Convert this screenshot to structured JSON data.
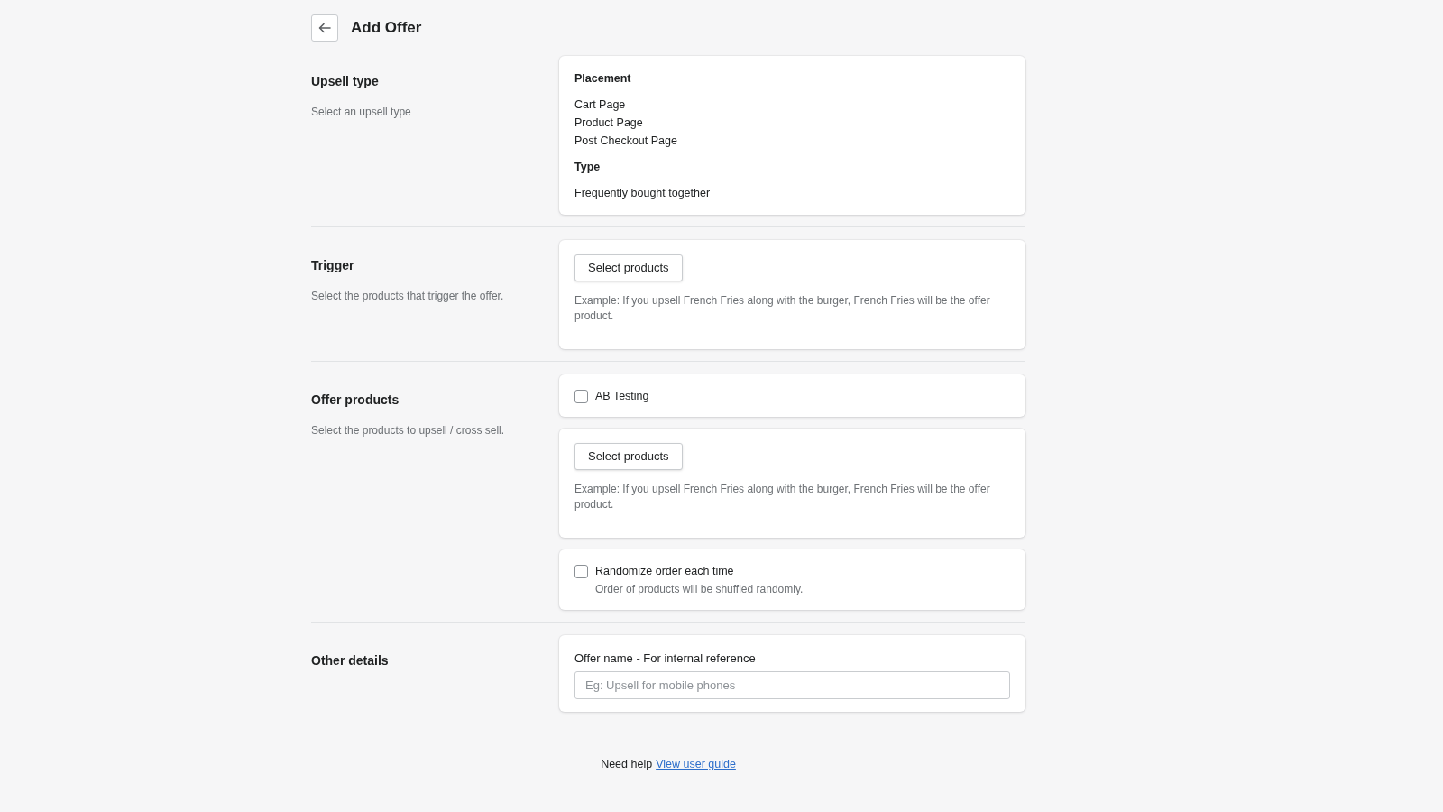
{
  "header": {
    "title": "Add Offer"
  },
  "sections": [
    {
      "title": "Upsell type",
      "description": "Select an upsell type",
      "cards": [
        {
          "blocks": [
            {
              "kind": "heading",
              "text": "Placement"
            },
            {
              "kind": "list",
              "items": [
                "Cart Page",
                "Product Page",
                "Post Checkout Page"
              ]
            },
            {
              "kind": "heading",
              "text": "Type"
            },
            {
              "kind": "list",
              "items": [
                "Frequently bought together"
              ]
            }
          ]
        }
      ]
    },
    {
      "title": "Trigger",
      "description": "Select the products that trigger the offer.",
      "cards": [
        {
          "blocks": [
            {
              "kind": "button",
              "text": "Select products"
            },
            {
              "kind": "hint",
              "text": "Example: If you upsell French Fries along with the burger, French Fries will be the offer product."
            }
          ]
        }
      ]
    },
    {
      "title": "Offer products",
      "description": "Select the products to upsell / cross sell.",
      "cards": [
        {
          "blocks": [
            {
              "kind": "checkbox",
              "label": "AB Testing",
              "checked": false
            }
          ]
        },
        {
          "blocks": [
            {
              "kind": "button",
              "text": "Select products"
            },
            {
              "kind": "hint",
              "text": "Example: If you upsell French Fries along with the burger, French Fries will be the offer product."
            }
          ]
        },
        {
          "blocks": [
            {
              "kind": "checkbox",
              "label": "Randomize order each time",
              "help": "Order of products will be shuffled randomly.",
              "checked": false
            }
          ]
        }
      ]
    },
    {
      "title": "Other details",
      "cards": [
        {
          "blocks": [
            {
              "kind": "field",
              "label": "Offer name - For internal reference",
              "placeholder": "Eg: Upsell for mobile phones"
            }
          ]
        }
      ]
    }
  ],
  "footer": {
    "text": "Need help",
    "link": "View user guide"
  }
}
